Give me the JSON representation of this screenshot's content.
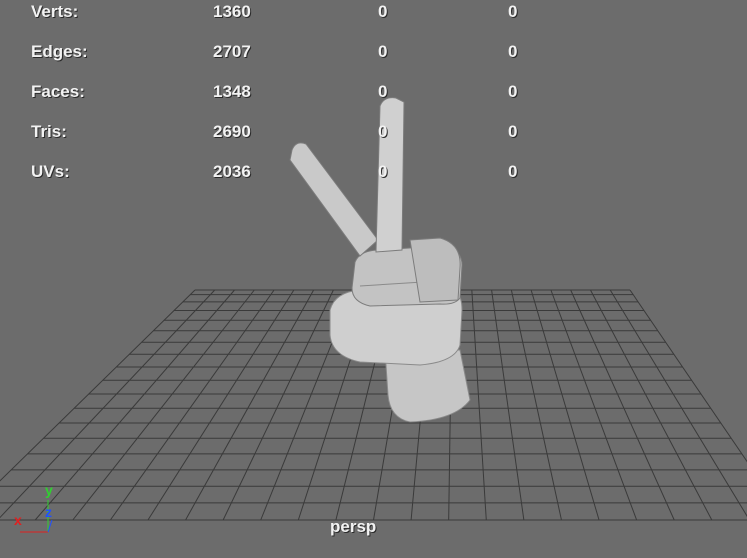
{
  "heads_up": {
    "rows": [
      {
        "label": "Verts:",
        "total": "1360",
        "selected": "0",
        "extra": "0"
      },
      {
        "label": "Edges:",
        "total": "2707",
        "selected": "0",
        "extra": "0"
      },
      {
        "label": "Faces:",
        "total": "1348",
        "selected": "0",
        "extra": "0"
      },
      {
        "label": "Tris:",
        "total": "2690",
        "selected": "0",
        "extra": "0"
      },
      {
        "label": "UVs:",
        "total": "2036",
        "selected": "0",
        "extra": "0"
      }
    ]
  },
  "viewport": {
    "camera_label": "persp",
    "model": "hand-peace-sign",
    "background_color": "#6c6c6c",
    "grid_color": "#3c3c3c",
    "model_color": "#c8c8c8"
  },
  "axis_gizmo": {
    "x_label": "x",
    "y_label": "y",
    "z_label": "z",
    "x_color": "#e02020",
    "y_color": "#30d030",
    "z_color": "#2050ff"
  }
}
